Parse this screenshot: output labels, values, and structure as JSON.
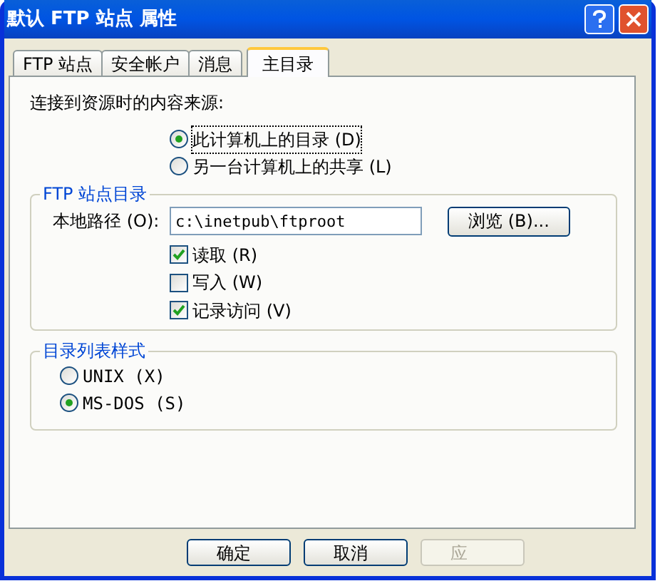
{
  "window": {
    "title": "默认 FTP 站点 属性"
  },
  "tabs": [
    {
      "label": "FTP 站点",
      "selected": false
    },
    {
      "label": "安全帐户",
      "selected": false
    },
    {
      "label": "消息",
      "selected": false
    },
    {
      "label": "主目录",
      "selected": true
    }
  ],
  "content_source": {
    "label": "连接到资源时的内容来源:",
    "options": [
      {
        "label": "此计算机上的目录 (D)",
        "selected": true
      },
      {
        "label": "另一台计算机上的共享 (L)",
        "selected": false
      }
    ]
  },
  "ftp_site_directory": {
    "title": "FTP 站点目录",
    "local_path_label": "本地路径 (O):",
    "local_path": "c:\\inetpub\\ftproot",
    "browse_button": "浏览 (B)...",
    "permissions": [
      {
        "label": "读取 (R)",
        "checked": true
      },
      {
        "label": "写入 (W)",
        "checked": false
      },
      {
        "label": "记录访问 (V)",
        "checked": true
      }
    ]
  },
  "listing_style": {
    "title": "目录列表样式",
    "options": [
      {
        "label": "UNIX (X)",
        "selected": false
      },
      {
        "label": "MS-DOS (S)",
        "selected": true
      }
    ]
  },
  "buttons": [
    {
      "label": "确定",
      "disabled": false
    },
    {
      "label": "取消",
      "disabled": false
    },
    {
      "label": "应",
      "disabled": true
    }
  ]
}
